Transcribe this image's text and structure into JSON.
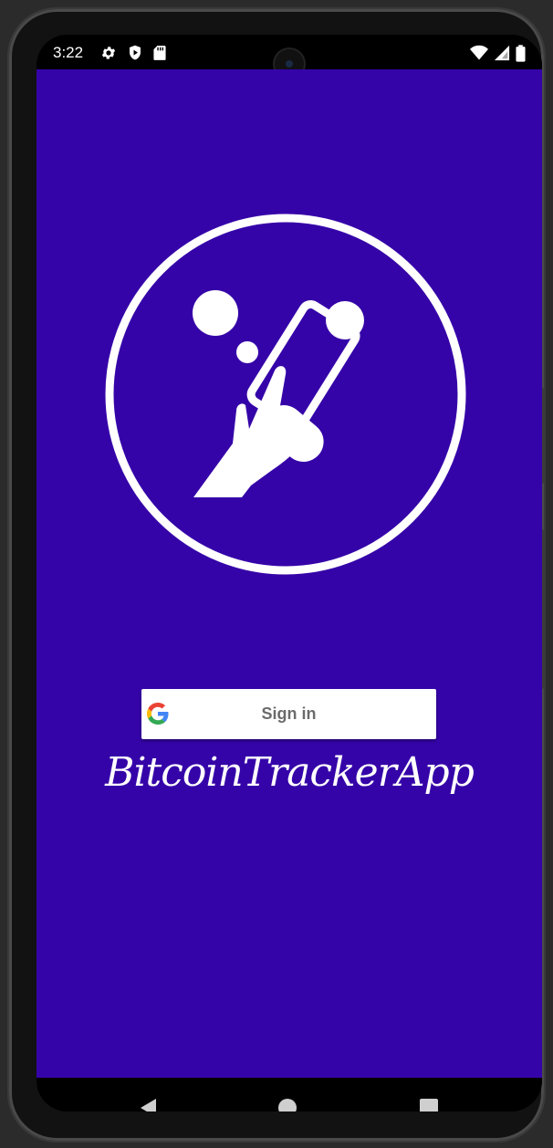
{
  "status_bar": {
    "time": "3:22",
    "left_icons": [
      "gear-icon",
      "shield-play-icon",
      "sd-card-icon"
    ],
    "right_icons": [
      "wifi-icon",
      "cell-signal-icon",
      "battery-icon"
    ]
  },
  "app": {
    "background_color": "#3504a8",
    "logo_icon": "hand-phone-tap-icon",
    "signin": {
      "label": "Sign in",
      "icon": "google-g-icon"
    },
    "title": "BitcoinTrackerApp"
  },
  "nav_bar": {
    "buttons": [
      "back",
      "home",
      "recents"
    ]
  }
}
